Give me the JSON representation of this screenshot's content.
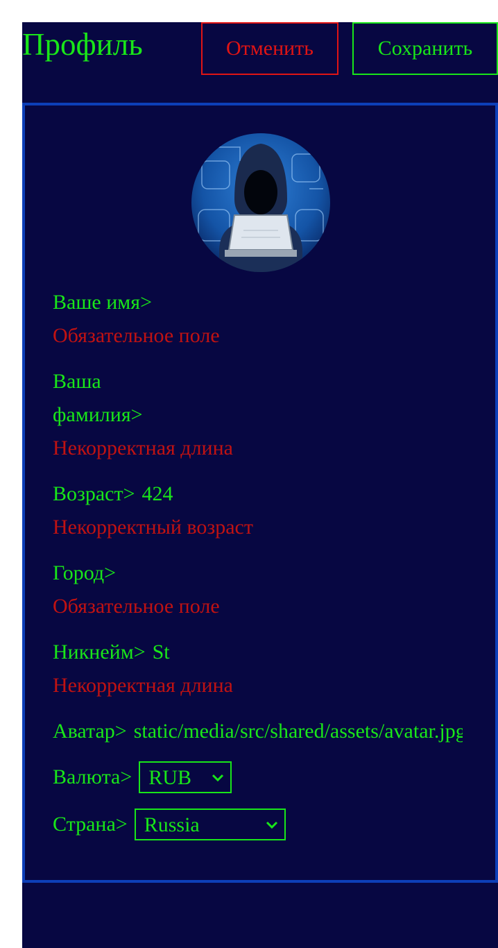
{
  "header": {
    "title": "Профиль",
    "cancel_label": "Отменить",
    "save_label": "Сохранить"
  },
  "colors": {
    "background": "#070742",
    "accent": "#19e619",
    "error": "#c01212",
    "cancel": "#e01414",
    "card_border": "#0d3fb8"
  },
  "avatar": {
    "icon": "hacker-avatar-image"
  },
  "form": {
    "first_name": {
      "label": "Ваше имя>",
      "value": "",
      "error": "Обязательное поле"
    },
    "last_name": {
      "label": "Ваша\nфамилия>",
      "value": "",
      "error": "Некорректная длина"
    },
    "age": {
      "label": "Возраст>",
      "value": "424",
      "error": "Некорректный возраст"
    },
    "city": {
      "label": "Город>",
      "value": "",
      "error": "Обязательное поле"
    },
    "username": {
      "label": "Никнейм>",
      "value": "St",
      "error": "Некорректная длина"
    },
    "avatar_url": {
      "label": "Аватар>",
      "value": "static/media/src/shared/assets/avatar.jpg"
    },
    "currency": {
      "label": "Валюта>",
      "value": "RUB"
    },
    "country": {
      "label": "Страна>",
      "value": "Russia"
    }
  }
}
